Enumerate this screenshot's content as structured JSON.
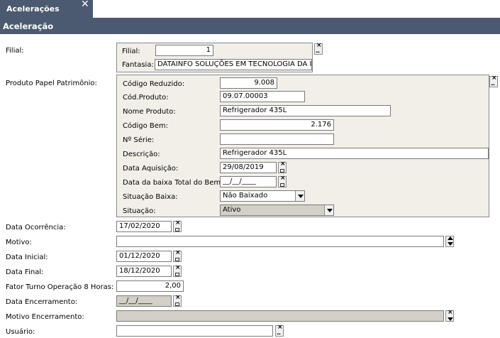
{
  "tab": {
    "title": "Acelerações",
    "close_glyph": "✕"
  },
  "header": {
    "title": "Aceleração"
  },
  "filial": {
    "label": "Filial:",
    "sub_label": "Filial:",
    "value": "1",
    "fantasia_label": "Fantasia:",
    "fantasia_value": "DATAINFO SOLUÇÕES EM TECNOLOGIA DA II"
  },
  "produto": {
    "label": "Produto Papel Patrimônio:",
    "codigo_reduzido_label": "Código Reduzido:",
    "codigo_reduzido": "9.008",
    "cod_produto_label": "Cód.Produto:",
    "cod_produto": "09.07.00003",
    "nome_produto_label": "Nome Produto:",
    "nome_produto": "Refrigerador 435L",
    "codigo_bem_label": "Código Bem:",
    "codigo_bem": "2.176",
    "numero_serie_label": "Nº Série:",
    "numero_serie": "",
    "descricao_label": "Descrição:",
    "descricao": "Refrigerador 435L",
    "data_aquisicao_label": "Data Aquisição:",
    "data_aquisicao": "29/08/2019",
    "data_baixa_label": "Data da baixa Total do Bem:",
    "data_baixa": "__/__/____",
    "situacao_baixa_label": "Situação Baixa:",
    "situacao_baixa": "Não Baixado",
    "situacao_label": "Situação:",
    "situacao": "Ativo"
  },
  "form": {
    "data_ocorrencia_label": "Data Ocorrência:",
    "data_ocorrencia": "17/02/2020",
    "motivo_label": "Motivo:",
    "motivo": "",
    "data_inicial_label": "Data Inicial:",
    "data_inicial": "01/12/2020",
    "data_final_label": "Data Final:",
    "data_final": "18/12/2020",
    "fator_label": "Fator Turno Operação 8 Horas:",
    "fator": "2,00",
    "data_encerramento_label": "Data Encerramento:",
    "data_encerramento": "__/__/____",
    "motivo_encerramento_label": "Motivo Encerramento:",
    "motivo_encerramento": "",
    "usuario_label": "Usuário:",
    "usuario": ""
  },
  "icons": {
    "clear": "×",
    "lookup": "...",
    "calendar": "calendar-icon",
    "dropdown": "chevron-down-icon"
  },
  "colors": {
    "header_bg": "#4b5a70",
    "panel_bg": "#f1efe8",
    "disabled_bg": "#d4d0c8"
  }
}
